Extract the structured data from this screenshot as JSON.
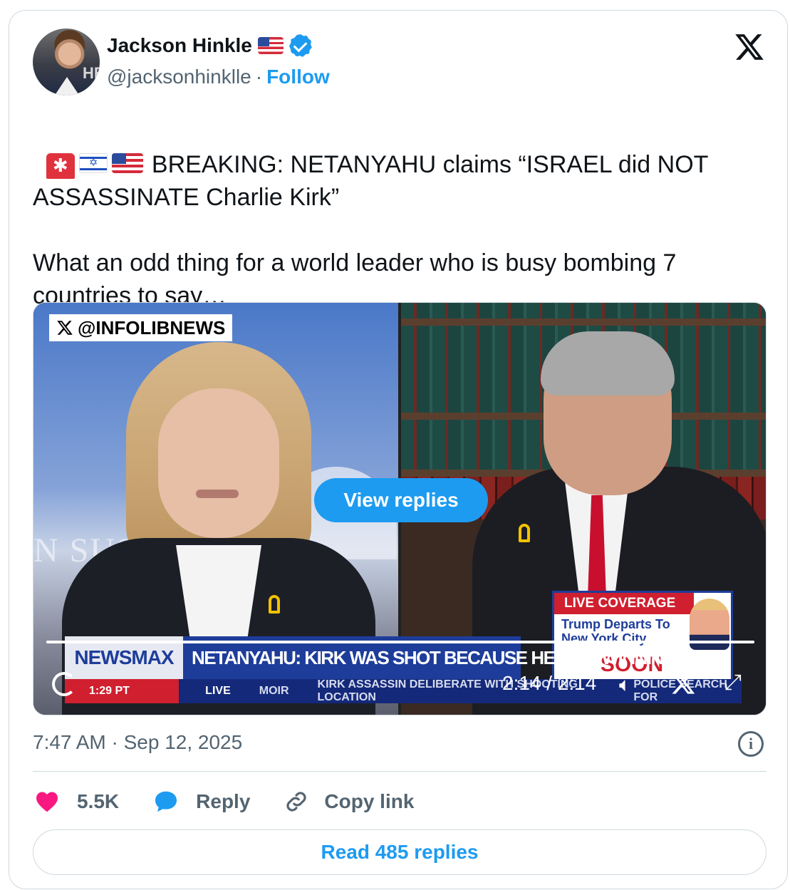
{
  "author": {
    "name": "Jackson Hinkle",
    "handle": "@jacksonhinklle",
    "separator": "·",
    "follow_label": "Follow",
    "avatar_text": "HB"
  },
  "tweet": {
    "text_line1": "BREAKING: NETANYAHU claims “ISRAEL did NOT ASSASSINATE Charlie Kirk”",
    "text_line2": "What an odd thing for a world leader who is busy bombing 7 countries to say…",
    "emojis": [
      "police-light",
      "israel-flag",
      "us-flag"
    ]
  },
  "video": {
    "watermark": "@INFOLIBNEWS",
    "view_replies_label": "View replies",
    "background_text": "N SUST",
    "live_box": {
      "header": "LIVE COVERAGE",
      "subtext": "Trump Departs To New York City",
      "soon": "SOON"
    },
    "lower_third": {
      "network": "NEWSMAX",
      "headline": "NETANYAHU: KIRK WAS SHOT BECAUSE HE WAS WINNING",
      "clock": "1:29 PT",
      "live": "LIVE",
      "ticker_1": "MOIR",
      "ticker_2": "KIRK ASSASSIN DELIBERATE WITH SHOOTING LOCATION",
      "ticker_3": "POLICE SEARCH FOR"
    },
    "time": "2:14 / 2:14",
    "progress": 1.0
  },
  "footer": {
    "timestamp": "7:47 AM · Sep 12, 2025",
    "likes": "5.5K",
    "reply_label": "Reply",
    "copy_link_label": "Copy link",
    "read_replies_label": "Read 485 replies"
  },
  "colors": {
    "accent": "#1d9bf0",
    "like": "#f91880",
    "muted": "#536471",
    "border": "#cfd9de"
  }
}
